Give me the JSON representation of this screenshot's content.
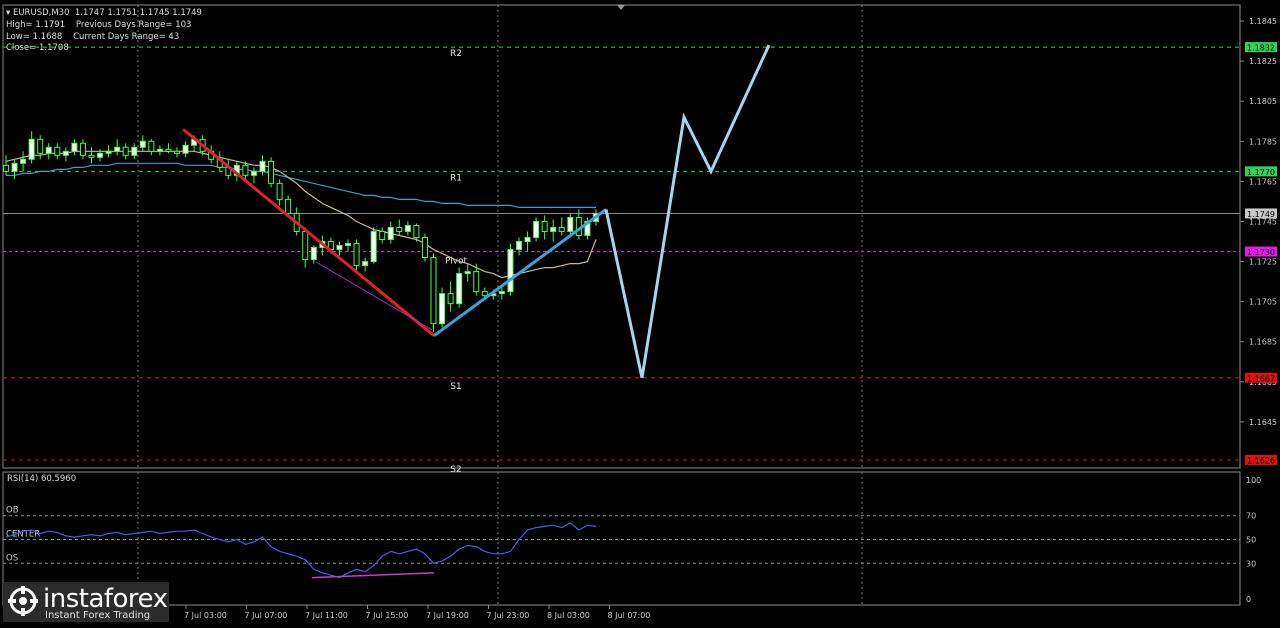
{
  "header": {
    "symbol_line": "EURUSD,M30  1.1747 1.1751 1.1745 1.1749",
    "high_label": "High= 1.1791",
    "prev_range_label": "Previous Days Range= 103",
    "low_label": "Low= 1.1688",
    "current_range_label": "Current Days Range= 43",
    "close_label": "Close= 1.1708"
  },
  "levels": {
    "r2": {
      "label": "R2",
      "price": 1.1832,
      "color": "#2bd45a"
    },
    "r1": {
      "label": "R1",
      "price": 1.177,
      "color": "#2bd45a"
    },
    "current": {
      "label": "1.1749",
      "price": 1.1749,
      "color": "#9a9a9a"
    },
    "pivot": {
      "label": "Pivot",
      "price": 1.173,
      "color": "#e81ae8"
    },
    "s1": {
      "label": "S1",
      "price": 1.1667,
      "color": "#e01010"
    },
    "s2": {
      "label": "S2",
      "price": 1.1626,
      "color": "#e01010"
    }
  },
  "price_axis_ticks": [
    "1.1845",
    "1.1825",
    "1.1805",
    "1.1785",
    "1.1765",
    "1.1745",
    "1.1725",
    "1.1705",
    "1.1685",
    "1.1665",
    "1.1645"
  ],
  "price_axis_labels": {
    "r2": "1.1832",
    "r1": "1.1770",
    "current": "1.1749",
    "pivot": "1.1730",
    "s1": "1.1667",
    "s2": "1.1626"
  },
  "rsi": {
    "title": "RSI(14) 60.5960",
    "ob_label": "OB",
    "center_label": "CENTER",
    "os_label": "OS",
    "ticks": [
      "100",
      "70",
      "50",
      "30",
      "0"
    ],
    "line_color": "#4a5be8",
    "divergence_color": "#c040c0"
  },
  "time_axis": [
    "7 Jul 03:00",
    "7 Jul 07:00",
    "7 Jul 11:00",
    "7 Jul 15:00",
    "7 Jul 19:00",
    "7 Jul 23:00",
    "8 Jul 03:00",
    "8 Jul 07:00"
  ],
  "annotations": {
    "down_trend_color": "#e0202a",
    "up_trend_color": "#3aa0e0",
    "forecast_color": "#a8d4ee"
  },
  "chart_data": {
    "type": "candlestick",
    "symbol": "EURUSD",
    "timeframe": "M30",
    "price_range": [
      1.1622,
      1.1853
    ],
    "candles": [
      [
        1.1773,
        1.1778,
        1.1768,
        1.177
      ],
      [
        1.177,
        1.1776,
        1.1766,
        1.1774
      ],
      [
        1.1774,
        1.178,
        1.177,
        1.1776
      ],
      [
        1.1776,
        1.179,
        1.1774,
        1.1786
      ],
      [
        1.1786,
        1.1788,
        1.1776,
        1.1779
      ],
      [
        1.1779,
        1.1784,
        1.1776,
        1.1782
      ],
      [
        1.1782,
        1.1784,
        1.1776,
        1.1778
      ],
      [
        1.1778,
        1.1782,
        1.1775,
        1.178
      ],
      [
        1.178,
        1.1786,
        1.1778,
        1.1784
      ],
      [
        1.1784,
        1.1786,
        1.1776,
        1.1778
      ],
      [
        1.1778,
        1.1782,
        1.1774,
        1.1777
      ],
      [
        1.1777,
        1.1781,
        1.1775,
        1.1779
      ],
      [
        1.1779,
        1.1783,
        1.1777,
        1.178
      ],
      [
        1.178,
        1.1786,
        1.1778,
        1.1782
      ],
      [
        1.1782,
        1.1784,
        1.1776,
        1.1778
      ],
      [
        1.1778,
        1.1784,
        1.1776,
        1.1782
      ],
      [
        1.1782,
        1.1788,
        1.178,
        1.1785
      ],
      [
        1.1785,
        1.1786,
        1.1778,
        1.178
      ],
      [
        1.178,
        1.1783,
        1.1778,
        1.1781
      ],
      [
        1.1781,
        1.1784,
        1.1779,
        1.178
      ],
      [
        1.178,
        1.1782,
        1.1777,
        1.1779
      ],
      [
        1.1779,
        1.1785,
        1.1777,
        1.1783
      ],
      [
        1.1783,
        1.1788,
        1.178,
        1.1786
      ],
      [
        1.1786,
        1.1788,
        1.1778,
        1.178
      ],
      [
        1.178,
        1.1783,
        1.1774,
        1.1776
      ],
      [
        1.1776,
        1.178,
        1.177,
        1.1772
      ],
      [
        1.1772,
        1.1776,
        1.1766,
        1.1768
      ],
      [
        1.1768,
        1.1775,
        1.1765,
        1.1773
      ],
      [
        1.1773,
        1.1775,
        1.1766,
        1.1768
      ],
      [
        1.1768,
        1.1772,
        1.1764,
        1.177
      ],
      [
        1.177,
        1.1778,
        1.1768,
        1.1775
      ],
      [
        1.1775,
        1.1777,
        1.1762,
        1.1764
      ],
      [
        1.1764,
        1.1766,
        1.1753,
        1.1756
      ],
      [
        1.1756,
        1.1758,
        1.1747,
        1.1749
      ],
      [
        1.1749,
        1.1752,
        1.1738,
        1.174
      ],
      [
        1.174,
        1.1742,
        1.1722,
        1.1726
      ],
      [
        1.1726,
        1.1733,
        1.1724,
        1.1732
      ],
      [
        1.1732,
        1.1738,
        1.1728,
        1.1735
      ],
      [
        1.1735,
        1.1737,
        1.1729,
        1.1731
      ],
      [
        1.1731,
        1.1735,
        1.1728,
        1.1733
      ],
      [
        1.1733,
        1.1736,
        1.173,
        1.1734
      ],
      [
        1.1734,
        1.1736,
        1.172,
        1.1723
      ],
      [
        1.1723,
        1.1727,
        1.172,
        1.1725
      ],
      [
        1.1725,
        1.1742,
        1.1724,
        1.174
      ],
      [
        1.174,
        1.1742,
        1.1734,
        1.1736
      ],
      [
        1.1736,
        1.1745,
        1.1734,
        1.1742
      ],
      [
        1.1742,
        1.1746,
        1.1738,
        1.174
      ],
      [
        1.174,
        1.1745,
        1.1738,
        1.1743
      ],
      [
        1.1743,
        1.1744,
        1.1735,
        1.1737
      ],
      [
        1.1737,
        1.1739,
        1.1725,
        1.1727
      ],
      [
        1.1727,
        1.1729,
        1.169,
        1.1694
      ],
      [
        1.1694,
        1.1712,
        1.1692,
        1.1709
      ],
      [
        1.1709,
        1.1715,
        1.17,
        1.1704
      ],
      [
        1.1704,
        1.1722,
        1.1702,
        1.1719
      ],
      [
        1.1719,
        1.1724,
        1.1715,
        1.172
      ],
      [
        1.172,
        1.1724,
        1.1708,
        1.171
      ],
      [
        1.171,
        1.1712,
        1.1706,
        1.1708
      ],
      [
        1.1708,
        1.1711,
        1.1706,
        1.1709
      ],
      [
        1.1709,
        1.1712,
        1.1706,
        1.171
      ],
      [
        1.171,
        1.1734,
        1.1708,
        1.1731
      ],
      [
        1.1731,
        1.1737,
        1.1728,
        1.1735
      ],
      [
        1.1735,
        1.174,
        1.173,
        1.1737
      ],
      [
        1.1737,
        1.1747,
        1.1735,
        1.1745
      ],
      [
        1.1745,
        1.1748,
        1.1736,
        1.174
      ],
      [
        1.174,
        1.1746,
        1.1735,
        1.1742
      ],
      [
        1.1742,
        1.1747,
        1.1738,
        1.174
      ],
      [
        1.174,
        1.1749,
        1.1737,
        1.1747
      ],
      [
        1.1747,
        1.1751,
        1.1736,
        1.1738
      ],
      [
        1.1738,
        1.1747,
        1.1736,
        1.1745
      ],
      [
        1.1745,
        1.1751,
        1.1743,
        1.1749
      ]
    ],
    "ma_slow": [
      1.1768,
      1.1768,
      1.1769,
      1.1769,
      1.177,
      1.177,
      1.1771,
      1.1771,
      1.1772,
      1.1772,
      1.1773,
      1.1773,
      1.1773,
      1.1774,
      1.1774,
      1.1774,
      1.1774,
      1.1774,
      1.1774,
      1.1774,
      1.1774,
      1.1773,
      1.1773,
      1.1773,
      1.1773,
      1.1772,
      1.1772,
      1.1771,
      1.1771,
      1.177,
      1.177,
      1.1769,
      1.1768,
      1.1767,
      1.1766,
      1.1765,
      1.1764,
      1.1763,
      1.1762,
      1.1761,
      1.176,
      1.1759,
      1.1758,
      1.1758,
      1.1757,
      1.1757,
      1.1756,
      1.1756,
      1.1756,
      1.1755,
      1.1755,
      1.1754,
      1.1754,
      1.1754,
      1.1753,
      1.1753,
      1.1753,
      1.1753,
      1.1753,
      1.1753,
      1.1752,
      1.1752,
      1.1752,
      1.1752,
      1.1752,
      1.1752,
      1.1752,
      1.1752,
      1.1752,
      1.1752
    ],
    "ma_fast": [
      1.1775,
      1.1776,
      1.1777,
      1.1778,
      1.1778,
      1.1779,
      1.1779,
      1.1779,
      1.178,
      1.178,
      1.178,
      1.178,
      1.178,
      1.178,
      1.178,
      1.178,
      1.178,
      1.178,
      1.178,
      1.178,
      1.178,
      1.178,
      1.178,
      1.1779,
      1.1778,
      1.1777,
      1.1776,
      1.1775,
      1.1774,
      1.1773,
      1.1773,
      1.1772,
      1.177,
      1.1767,
      1.1764,
      1.176,
      1.1757,
      1.1754,
      1.1752,
      1.175,
      1.1748,
      1.1745,
      1.1743,
      1.1741,
      1.174,
      1.1739,
      1.1738,
      1.1737,
      1.1736,
      1.1734,
      1.1731,
      1.1729,
      1.1727,
      1.1725,
      1.1724,
      1.1722,
      1.172,
      1.1719,
      1.1717,
      1.1718,
      1.1719,
      1.172,
      1.1721,
      1.1722,
      1.1722,
      1.1723,
      1.1724,
      1.1724,
      1.1725,
      1.1736
    ],
    "rsi_values": [
      52,
      54,
      57,
      58,
      55,
      57,
      56,
      53,
      52,
      53,
      54,
      53,
      55,
      56,
      54,
      55,
      56,
      57,
      55,
      56,
      57,
      57,
      58,
      55,
      52,
      50,
      48,
      50,
      46,
      48,
      52,
      44,
      40,
      38,
      36,
      33,
      25,
      22,
      20,
      18,
      22,
      25,
      23,
      28,
      36,
      40,
      38,
      40,
      42,
      38,
      30,
      32,
      36,
      42,
      45,
      44,
      40,
      38,
      38,
      40,
      50,
      58,
      60,
      61,
      62,
      60,
      64,
      58,
      62,
      61
    ],
    "down_trend": {
      "from_index": 24,
      "from_price": 1.1791,
      "to_index": 50,
      "to_price": 1.1688
    },
    "up_trend": {
      "from_index": 50,
      "from_price": 1.1688,
      "to_index": 70,
      "to_price": 1.1751
    },
    "forecast_path": [
      {
        "time": "8 Jul 07:30",
        "price": 1.1751
      },
      {
        "time": "8 Jul 09:00",
        "price": 1.1667
      },
      {
        "time": "8 Jul 10:30",
        "price": 1.1797
      },
      {
        "time": "8 Jul 11:30",
        "price": 1.177
      },
      {
        "time": "8 Jul 13:00",
        "price": 1.1833
      }
    ]
  }
}
